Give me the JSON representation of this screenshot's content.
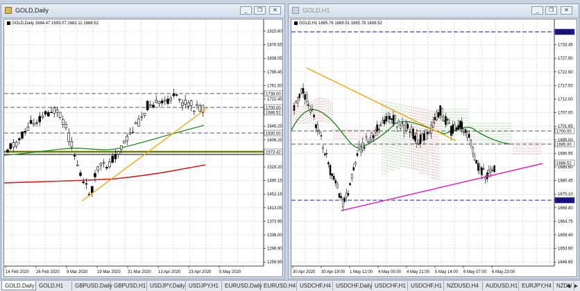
{
  "left_window": {
    "title": "GOLD,Daily",
    "symbol_line": "GOLD,Daily  1684.47 1693.07 1682.11 1688.52",
    "price_ticks": [
      "1915.60",
      "1876.55",
      "1838.05",
      "1799.45",
      "1761.50",
      "1722.45",
      "1684.00",
      "1645.25",
      "1606.25",
      "1567.70",
      "1529.20",
      "1490.15",
      "1452.15",
      "1413.05",
      "1373.95",
      "1336.00",
      "1296.90",
      "1258.95"
    ],
    "level_labels": [
      {
        "text": "1738.00",
        "color": "#000000",
        "bg": "#ffffff"
      },
      {
        "text": "1700.00",
        "color": "#000000",
        "bg": "#ffffff"
      },
      {
        "text": "1688.52",
        "color": "#000000",
        "bg": "#ffffff"
      },
      {
        "text": "1630.00",
        "color": "#000000",
        "bg": "#ffffff"
      },
      {
        "text": "1573.42",
        "color": "#000000",
        "bg": "#ffffff"
      }
    ],
    "date_ticks": [
      "14 Feb 2020",
      "26 Feb 2020",
      "9 Mar 2020",
      "19 Mar 2020",
      "31 Mar 2020",
      "13 Apr 2020",
      "23 Apr 2020",
      "5 May 2020"
    ]
  },
  "right_window": {
    "title": "GOLD,H1",
    "symbol_line": "GOLD,H1  1685.76 1689.91 1685.76 1688.52",
    "price_ticks": [
      "1738.00",
      "1733.45",
      "1727.90",
      "1722.90",
      "1717.50",
      "1712.00",
      "1707.00",
      "1701.65",
      "1695.00",
      "1690.95",
      "1685.60",
      "1680.45",
      "1675.10",
      "1669.80",
      "1664.75",
      "1659.40",
      "1653.90",
      "1648.65"
    ],
    "level_labels": [
      {
        "text": "1738.00",
        "color": "#ffffff",
        "bg": "#1a1aa0"
      },
      {
        "text": "1700.00",
        "color": "#000000",
        "bg": "#ffffff"
      },
      {
        "text": "1695.00",
        "color": "#000000",
        "bg": "#ffffff"
      },
      {
        "text": "1688.52",
        "color": "#000000",
        "bg": "#ffffff"
      },
      {
        "text": "1674.00",
        "color": "#ffffff",
        "bg": "#1a1aa0"
      }
    ],
    "date_ticks": [
      "30 Apr 2020",
      "30 Apr 19:00",
      "1 May 12:00",
      "4 May 05:00",
      "4 May 21:00",
      "5 May 14:00",
      "6 May 07:00",
      "6 May 23:00"
    ]
  },
  "window_buttons": {
    "minimize": "_",
    "restore": "❐",
    "close": "✕"
  },
  "tabs": [
    "GOLD,Daily",
    "GOLD,H1",
    "GBPUSD,Daily",
    "GBPUSD,H1",
    "USDJPY,Daily",
    "USDJPY,H1",
    "EURUSD,Daily",
    "EURUSD,H4",
    "USDCHF,H4",
    "USDCHF,Daily",
    "USDCHF,H1",
    "USDCHF,H1",
    "NZDUSD,H4",
    "AUDUSD,H1",
    "EURJPY,H4",
    "NZDU"
  ],
  "active_tab": "GOLD,Daily",
  "colors": {
    "chart_bg": "#ffffff",
    "ma_green": "#1e8a1e",
    "ma_red": "#d81818",
    "trend_orange": "#f5a000",
    "trend_magenta": "#e020c0",
    "level_blue": "#1a1aa0",
    "support_olive": "#6b7d00"
  }
}
